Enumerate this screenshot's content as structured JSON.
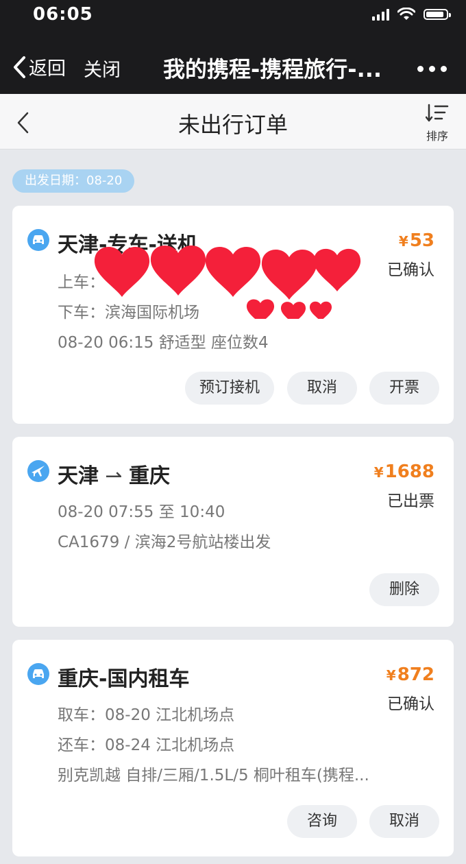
{
  "status_bar": {
    "time": "06:05"
  },
  "browser_nav": {
    "back_label": "返回",
    "close_label": "关闭",
    "title": "我的携程-携程旅行-..."
  },
  "app_header": {
    "title": "未出行订单",
    "sort_label": "排序"
  },
  "date_chip": "出发日期：08-20",
  "colors": {
    "accent": "#4aa6f0",
    "price": "#f07f1e",
    "chip": "#a9d3f2",
    "redaction": "#f4203a"
  },
  "orders": [
    {
      "icon": "car-icon",
      "title": "天津-专车-送机",
      "price_symbol": "¥",
      "price": "53",
      "status": "已确认",
      "lines": [
        "上车：",
        "下车：滨海国际机场",
        "08-20 06:15 舒适型 座位数4"
      ],
      "buttons": [
        "预订接机",
        "取消",
        "开票"
      ]
    },
    {
      "icon": "plane-icon",
      "title_from": "天津",
      "title_to": "重庆",
      "price_symbol": "¥",
      "price": "1688",
      "status": "已出票",
      "lines": [
        "08-20 07:55 至 10:40",
        "CA1679 / 滨海2号航站楼出发"
      ],
      "buttons": [
        "删除"
      ]
    },
    {
      "icon": "car-icon",
      "title": "重庆-国内租车",
      "price_symbol": "¥",
      "price": "872",
      "status": "已确认",
      "lines": [
        "取车：08-20 江北机场点",
        "还车：08-24 江北机场点",
        "别克凯越 自排/三厢/1.5L/5 桐叶租车(携程..."
      ],
      "buttons": [
        "咨询",
        "取消"
      ]
    }
  ]
}
